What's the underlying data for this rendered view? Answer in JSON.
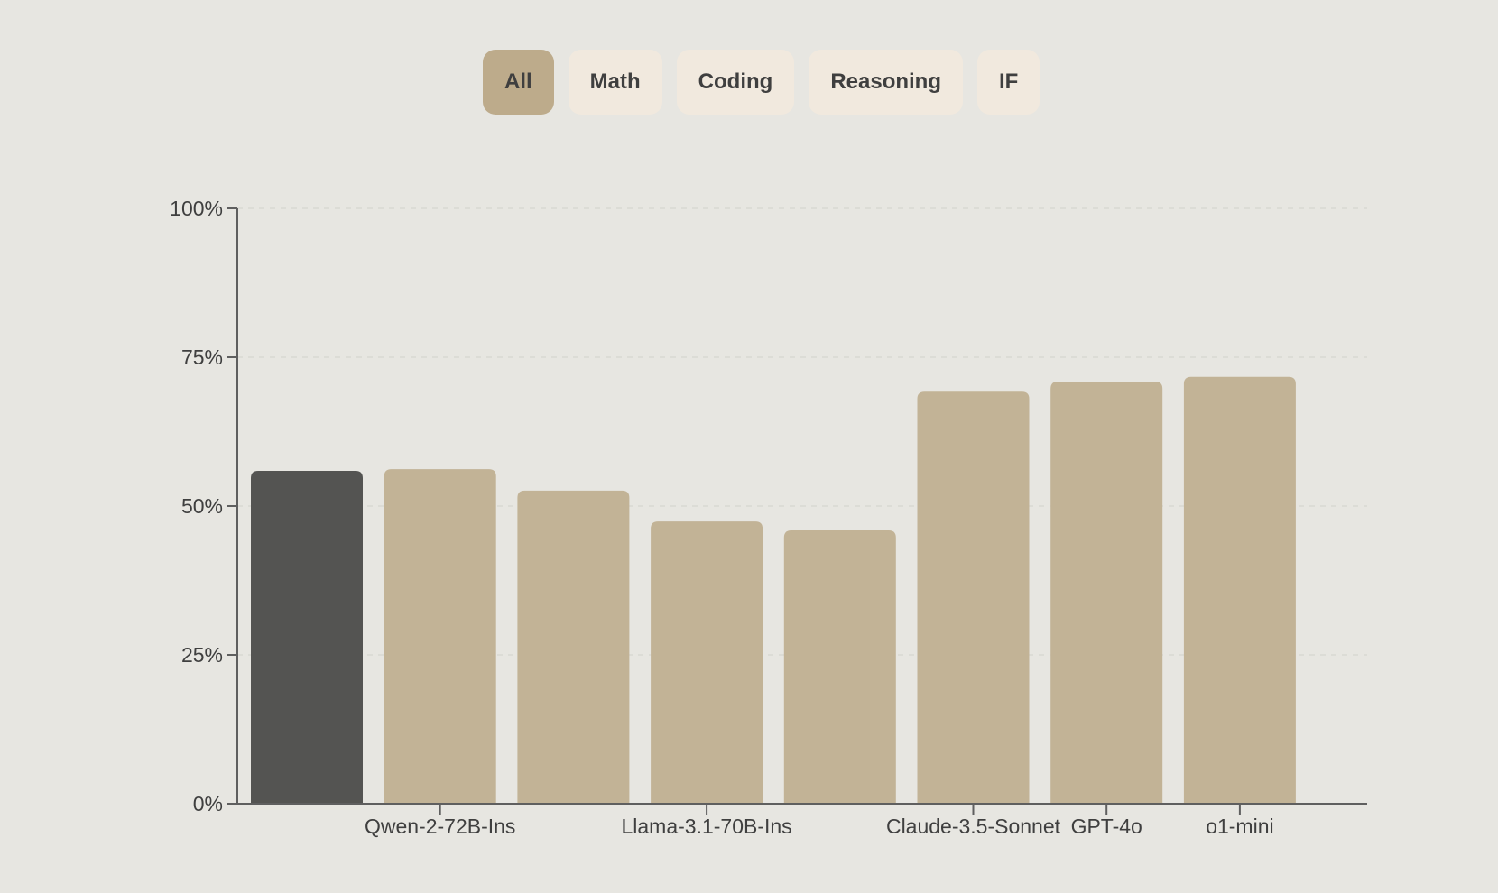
{
  "filters": {
    "items": [
      {
        "label": "All",
        "active": true
      },
      {
        "label": "Math",
        "active": false
      },
      {
        "label": "Coding",
        "active": false
      },
      {
        "label": "Reasoning",
        "active": false
      },
      {
        "label": "IF",
        "active": false
      }
    ]
  },
  "colors": {
    "background": "#e7e6e1",
    "highlight_bar": "#545452",
    "default_bar": "#c2b396",
    "axis": "#5f5f5f",
    "grid": "#d9d8d3",
    "filter_active": "#bdab8b",
    "filter_inactive": "#f1e9de"
  },
  "chart_data": {
    "type": "bar",
    "title": "",
    "xlabel": "",
    "ylabel": "",
    "ylim": [
      0,
      100
    ],
    "yticks": [
      0,
      25,
      50,
      75,
      100
    ],
    "ytick_labels": [
      "0%",
      "25%",
      "50%",
      "75%",
      "100%"
    ],
    "grid": true,
    "categories": [
      "",
      "Qwen-2-72B-Ins",
      "",
      "Llama-3.1-70B-Ins",
      "",
      "Claude-3.5-Sonnet",
      "GPT-4o",
      "o1-mini"
    ],
    "values": [
      55.9,
      56.2,
      52.6,
      47.4,
      45.9,
      69.2,
      70.9,
      71.7
    ],
    "highlight_index": 0
  }
}
